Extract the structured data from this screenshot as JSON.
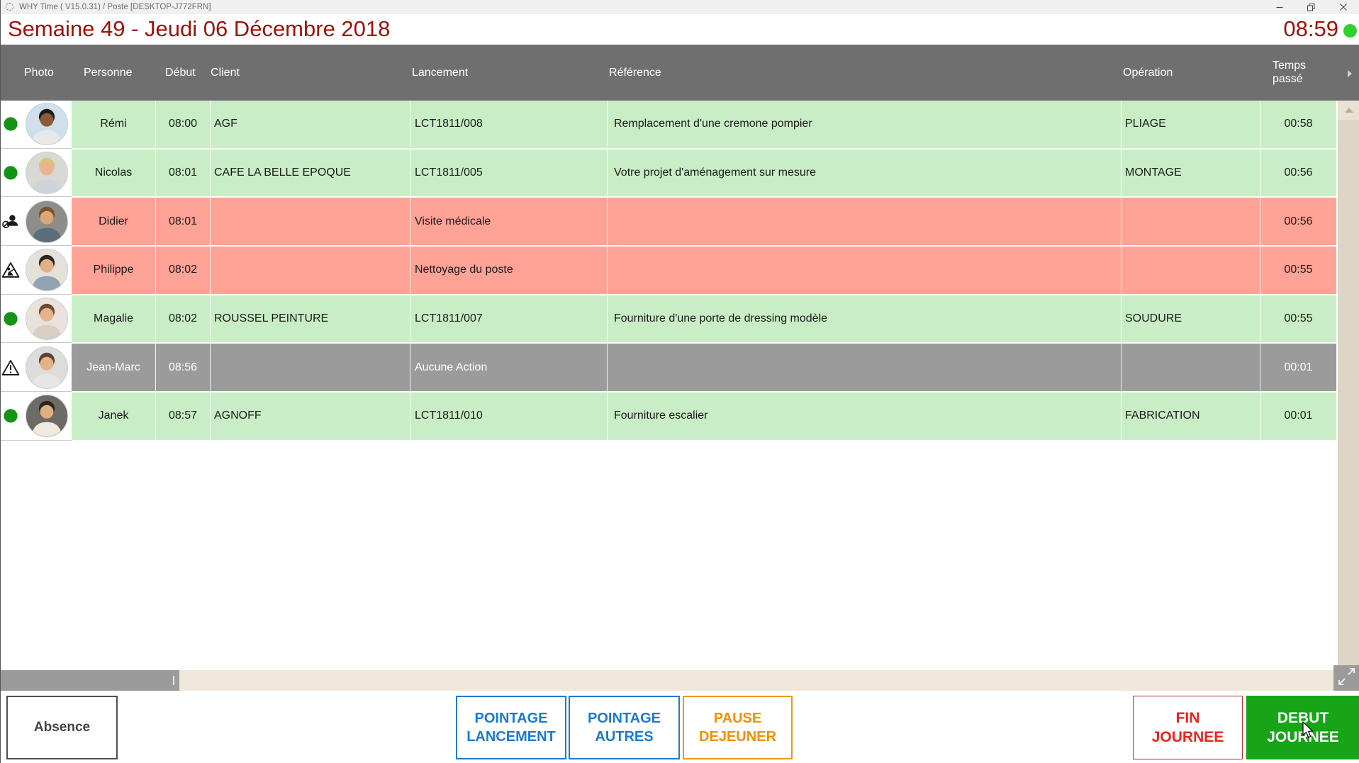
{
  "window": {
    "title": "WHY Time ( V15.0.31) / Poste [DESKTOP-J772FRN]"
  },
  "topbar": {
    "date_title": "Semaine 49 - Jeudi 06 Décembre 2018",
    "clock": "08:59"
  },
  "table": {
    "columns": [
      "Photo",
      "Personne",
      "Début",
      "Client",
      "Lancement",
      "Référence",
      "Opération",
      "Temps passé"
    ],
    "rows": [
      {
        "name": "Rémi",
        "start": "08:00",
        "client": "AGF",
        "lancement": "LCT1811/008",
        "reference": "Remplacement d'une cremone pompier",
        "operation": "PLIAGE",
        "elapsed": "00:58",
        "row_color": "green",
        "status_icon": "green-dot",
        "avatar": {
          "bg": "#cfe0ec",
          "skin": "#8a5a3b",
          "hair": "#1e1a17",
          "shirt": "#e8e8e8"
        }
      },
      {
        "name": "Nicolas",
        "start": "08:01",
        "client": "CAFE LA BELLE EPOQUE",
        "lancement": "LCT1811/005",
        "reference": "Votre projet d'aménagement sur mesure",
        "operation": "MONTAGE",
        "elapsed": "00:56",
        "row_color": "green",
        "status_icon": "green-dot",
        "avatar": {
          "bg": "#d8d8d4",
          "skin": "#e8b48e",
          "hair": "#d9c27e",
          "shirt": "#cfd4d8"
        }
      },
      {
        "name": "Didier",
        "start": "08:01",
        "client": "",
        "lancement": "Visite médicale",
        "reference": "",
        "operation": "",
        "elapsed": "00:56",
        "row_color": "red",
        "status_icon": "person-absent",
        "avatar": {
          "bg": "#8f8d8a",
          "skin": "#d9a877",
          "hair": "#7a5230",
          "shirt": "#5a6e7e"
        }
      },
      {
        "name": "Philippe",
        "start": "08:02",
        "client": "",
        "lancement": "Nettoyage du poste",
        "reference": "",
        "operation": "",
        "elapsed": "00:55",
        "row_color": "red",
        "status_icon": "roadworks",
        "avatar": {
          "bg": "#e4e0da",
          "skin": "#e3b089",
          "hair": "#2e2620",
          "shirt": "#8fa3b0"
        }
      },
      {
        "name": "Magalie",
        "start": "08:02",
        "client": "ROUSSEL PEINTURE",
        "lancement": "LCT1811/007",
        "reference": "Fourniture d'une porte de dressing modèle",
        "operation": "SOUDURE",
        "elapsed": "00:55",
        "row_color": "green",
        "status_icon": "green-dot",
        "avatar": {
          "bg": "#e8e2da",
          "skin": "#e6b48c",
          "hair": "#6e4a2e",
          "shirt": "#d8cfc4"
        }
      },
      {
        "name": "Jean-Marc",
        "start": "08:56",
        "client": "",
        "lancement": "Aucune Action",
        "reference": "",
        "operation": "",
        "elapsed": "00:01",
        "row_color": "gray",
        "status_icon": "warning",
        "avatar": {
          "bg": "#dcdcda",
          "skin": "#e2b28a",
          "hair": "#5a4632",
          "shirt": "#e6e6e2"
        }
      },
      {
        "name": "Janek",
        "start": "08:57",
        "client": "AGNOFF",
        "lancement": "LCT1811/010",
        "reference": "Fourniture escalier",
        "operation": "FABRICATION",
        "elapsed": "00:01",
        "row_color": "green",
        "status_icon": "green-dot",
        "avatar": {
          "bg": "#6e6a66",
          "skin": "#dfae84",
          "hair": "#2a241e",
          "shirt": "#efe9e0"
        }
      }
    ]
  },
  "footer": {
    "absence": "Absence",
    "pointage_lancement": "POINTAGE\nLANCEMENT",
    "pointage_autres": "POINTAGE\nAUTRES",
    "pause_dejeuner": "PAUSE\nDEJEUNER",
    "fin_journee": "FIN\nJOURNEE",
    "debut_journee": "DEBUT\nJOURNEE"
  },
  "colors": {
    "title_red": "#a01108",
    "clock_dot_green": "#2fd12f",
    "header_gray": "#6f6f6f",
    "row_green": "#c9eec6",
    "row_red": "#ffa396",
    "row_gray": "#9b9b9b",
    "status_dot_green": "#149314",
    "accent_blue": "#1b7ad2",
    "accent_orange": "#f39000",
    "accent_red": "#e6281a",
    "button_green": "#17a517"
  }
}
